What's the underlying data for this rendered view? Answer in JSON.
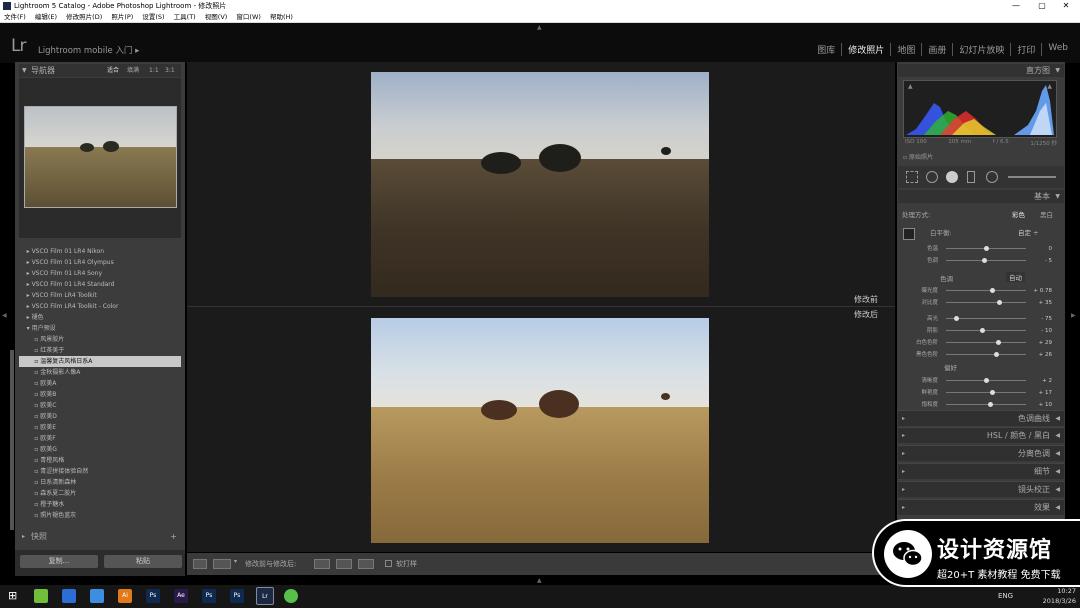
{
  "window": {
    "title": "Lightroom 5 Catalog - Adobe Photoshop Lightroom - 修改照片",
    "min": "—",
    "max": "▢",
    "close": "✕"
  },
  "menu": [
    "文件(F)",
    "编辑(E)",
    "修改照片(D)",
    "照片(P)",
    "设置(S)",
    "工具(T)",
    "视图(V)",
    "窗口(W)",
    "帮助(H)"
  ],
  "identity": {
    "logo": "Lr",
    "text": "Lightroom mobile 入门",
    "arrow": "▸"
  },
  "modules": [
    "图库",
    "修改照片",
    "地图",
    "画册",
    "幻灯片放映",
    "打印",
    "Web"
  ],
  "left": {
    "navigator": {
      "title": "导航器",
      "zoom": [
        "适合",
        "填满",
        "1:1",
        "3:1"
      ]
    },
    "presets": [
      {
        "label": "VSCO Film 01 LR4 Nikon",
        "type": "folder"
      },
      {
        "label": "VSCO Film 01 LR4 Olympus",
        "type": "folder"
      },
      {
        "label": "VSCO Film 01 LR4 Sony",
        "type": "folder"
      },
      {
        "label": "VSCO Film 01 LR4 Standard",
        "type": "folder"
      },
      {
        "label": "VSCO Film LR4 Toolkit",
        "type": "folder"
      },
      {
        "label": "VSCO Film LR4 Toolkit - Color",
        "type": "folder"
      },
      {
        "label": "褪色",
        "type": "folder"
      },
      {
        "label": "用户预设",
        "type": "open"
      },
      {
        "label": "风景胶片",
        "type": "item"
      },
      {
        "label": "红茶美于",
        "type": "item"
      },
      {
        "label": "温馨复古风格日系A",
        "type": "item",
        "selected": true
      },
      {
        "label": "金秋摄影人像A",
        "type": "item"
      },
      {
        "label": "欧美A",
        "type": "item"
      },
      {
        "label": "欧美B",
        "type": "item"
      },
      {
        "label": "欧美C",
        "type": "item"
      },
      {
        "label": "欧美D",
        "type": "item"
      },
      {
        "label": "欧美E",
        "type": "item"
      },
      {
        "label": "欧美F",
        "type": "item"
      },
      {
        "label": "欧美G",
        "type": "item"
      },
      {
        "label": "青橙风格",
        "type": "item"
      },
      {
        "label": "青涩拼接体验自然",
        "type": "item"
      },
      {
        "label": "日系清新森林",
        "type": "item"
      },
      {
        "label": "森系夏二胶片",
        "type": "item"
      },
      {
        "label": "橙子糖水",
        "type": "item"
      },
      {
        "label": "照片褪色蓝灰",
        "type": "item"
      }
    ],
    "snapshots": "快照",
    "copy_btn": "复制...",
    "paste_btn": "粘贴"
  },
  "center": {
    "before_label": "修改前",
    "after_label": "修改后"
  },
  "toolbar": {
    "compare_label": "修改前与修改后:",
    "softproof": "软打样"
  },
  "right": {
    "histogram_title": "直方图",
    "histo_info": [
      "ISO 100",
      "105 mm",
      "f / 6.5",
      "1/1250 秒"
    ],
    "original_photo": "原始照片",
    "basic_title": "基本",
    "treatment": {
      "label": "处理方式:",
      "color": "彩色",
      "bw": "黑白"
    },
    "wb": {
      "label": "白平衡:",
      "value": "自定"
    },
    "sliders": [
      {
        "label": "色温",
        "value": "0",
        "pos": 0.5,
        "group": "wb"
      },
      {
        "label": "色调",
        "value": "- 5",
        "pos": 0.48,
        "group": "wb"
      },
      {
        "label": "曝光度",
        "value": "+ 0.78",
        "pos": 0.58,
        "group": "tone"
      },
      {
        "label": "对比度",
        "value": "+ 35",
        "pos": 0.67,
        "group": "tone"
      },
      {
        "label": "高光",
        "value": "- 75",
        "pos": 0.13,
        "group": "tone2"
      },
      {
        "label": "阴影",
        "value": "- 10",
        "pos": 0.45,
        "group": "tone2"
      },
      {
        "label": "白色色阶",
        "value": "+ 29",
        "pos": 0.65,
        "group": "tone2"
      },
      {
        "label": "黑色色阶",
        "value": "+ 26",
        "pos": 0.63,
        "group": "tone2"
      },
      {
        "label": "清晰度",
        "value": "+ 2",
        "pos": 0.51,
        "group": "presence"
      },
      {
        "label": "鲜艳度",
        "value": "+ 17",
        "pos": 0.58,
        "group": "presence"
      },
      {
        "label": "饱和度",
        "value": "+ 10",
        "pos": 0.55,
        "group": "presence"
      }
    ],
    "tone": {
      "label": "色调",
      "auto": "自动"
    },
    "presence": "偏好",
    "sections": [
      "色调曲线",
      "HSL / 颜色 / 黑白",
      "分离色调",
      "细节",
      "镜头校正",
      "效果"
    ]
  },
  "watermark": {
    "title": "设计资源馆",
    "subtitle": "超20+T 素材教程 免费下载"
  },
  "taskbar": {
    "lang": "ENG",
    "time": "10:27",
    "date": "2018/3/26",
    "apps": [
      "Ai",
      "Ps",
      "Ae",
      "Ps",
      "Ps",
      "Lr"
    ]
  },
  "colors": {
    "panel": "#3c3c3c",
    "bg": "#000000",
    "select": "#c8c8c8"
  }
}
